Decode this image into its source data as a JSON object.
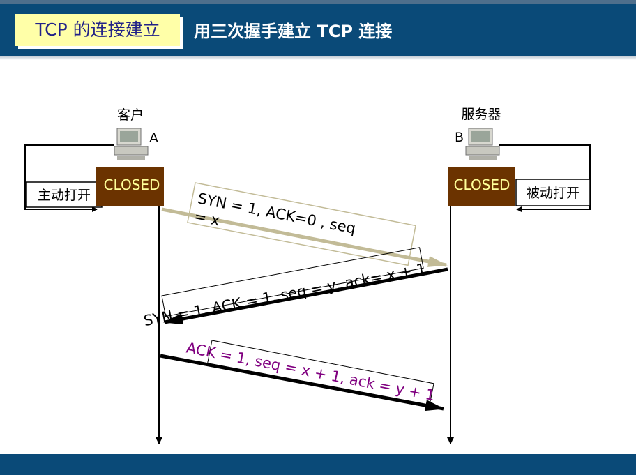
{
  "header": {
    "title": "TCP 的连接建立",
    "subtitle": "用三次握手建立 TCP 连接"
  },
  "client": {
    "label": "客户",
    "letter": "A",
    "state": "CLOSED",
    "open_label": "主动打开"
  },
  "server": {
    "label": "服务器",
    "letter": "B",
    "state": "CLOSED",
    "open_label": "被动打开"
  },
  "messages": {
    "syn": {
      "line1": "SYN = 1, ACK=0 , seq",
      "line2": "= x",
      "color": "#c2bb97"
    },
    "syn_ack": {
      "text": "SYN = 1, ACK = 1, seq = y, ack= x + 1",
      "color": "#000000"
    },
    "ack": {
      "text": "ACK = 1, seq = x + 1, ack = y + 1",
      "color": "#800080"
    }
  },
  "colors": {
    "header_bg": "#0a4a78",
    "title_bg": "#ffffa8",
    "state_box_bg": "#6b3300",
    "state_text": "#ffff99"
  }
}
